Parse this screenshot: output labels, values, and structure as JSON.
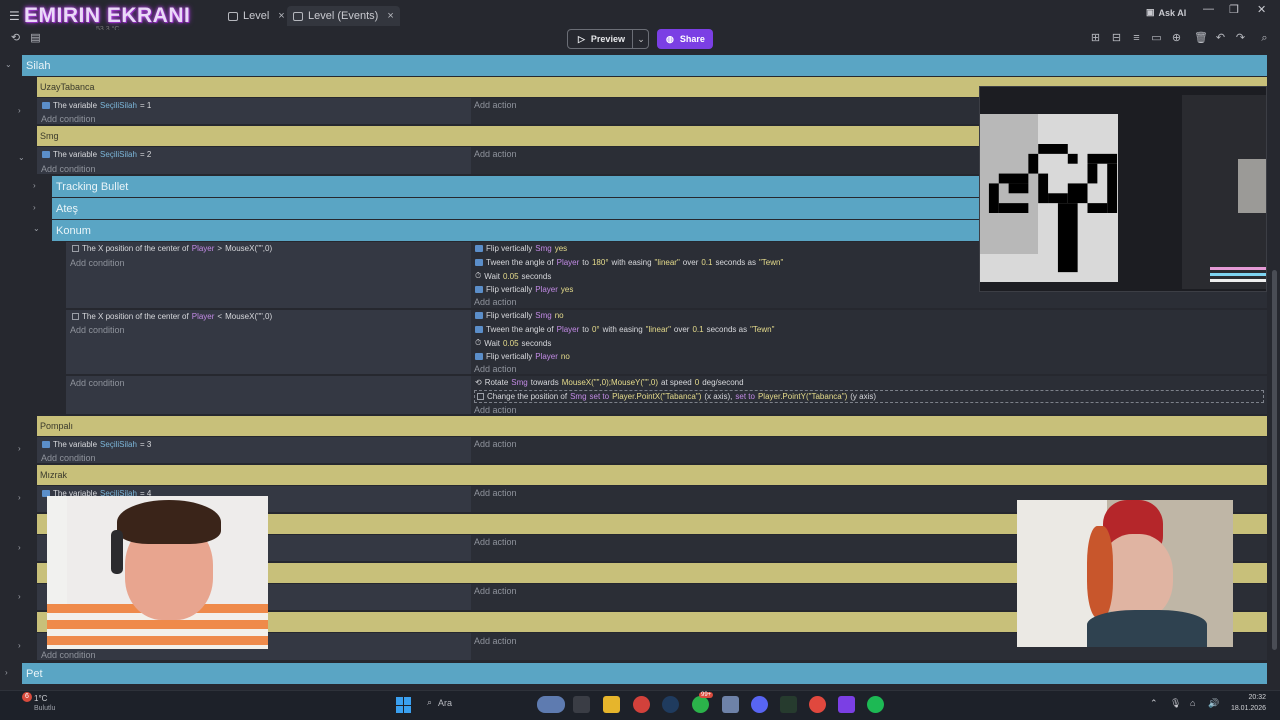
{
  "titlebar": {
    "overlay_title": "EMIRIN EKRANI",
    "tabs": [
      {
        "label": "Level"
      },
      {
        "label": "Level (Events)"
      }
    ],
    "ask_ai": "Ask AI",
    "fps_hint": "53.3 °C"
  },
  "toolbar": {
    "preview_label": "Preview",
    "share_label": "Share"
  },
  "events": {
    "group_silah": "Silah",
    "comment_uzay": "UzayTabanca",
    "cond_var": "The variable",
    "var_name": "SeçiliSilah",
    "eq1": "= 1",
    "eq2": "= 2",
    "eq3": "= 3",
    "eq4": "= 4",
    "add_condition": "Add condition",
    "add_action": "Add action",
    "comment_smg": "Smg",
    "group_tracking": "Tracking Bullet",
    "group_ates": "Ateş",
    "group_konum": "Konum",
    "konum": {
      "cond1_a": "The X position of the center of",
      "player": "Player",
      "gt": ">",
      "lt": "<",
      "mousex": "MouseX(\"\",0)",
      "flip_v": "Flip vertically",
      "smg": "Smg",
      "yes": "yes",
      "no": "no",
      "tween_a": "Tween the angle of",
      "to": "to",
      "deg180": "180°",
      "deg0": "0°",
      "with_easing": "with easing",
      "linear": "\"linear\"",
      "over": "over",
      "dur": "0.1",
      "seconds_as": "seconds as",
      "tewn": "\"Tewn\"",
      "wait": "Wait",
      "wait_val": "0.05",
      "seconds": "seconds",
      "rotate": "Rotate",
      "towards": "towards",
      "mouse_xy": "MouseX(\"\",0);MouseY(\"\",0)",
      "at_speed": "at speed",
      "speed_val": "0",
      "deg_per_sec": "deg/second",
      "change_pos": "Change the position of",
      "set_to": "set to",
      "pointx": "Player.PointX(\"Tabanca\")",
      "x_axis": "(x axis),",
      "pointy": "Player.PointY(\"Tabanca\")",
      "y_axis": "(y axis)"
    },
    "comment_pompali": "Pompalı",
    "comment_mizrak": "Mızrak",
    "group_pet": "Pet"
  },
  "taskbar": {
    "weather_temp": "1°C",
    "weather_desc": "Bulutlu",
    "search_label": "Ara",
    "badge": "6",
    "badge2": "99+",
    "time": "20:32",
    "date": "18.01.2026"
  },
  "colors": {
    "group_blue": "#5aa5c4",
    "comment_yellow": "#c8c07a",
    "share_purple": "#7b3fe4",
    "object_purple": "#c38be6"
  }
}
